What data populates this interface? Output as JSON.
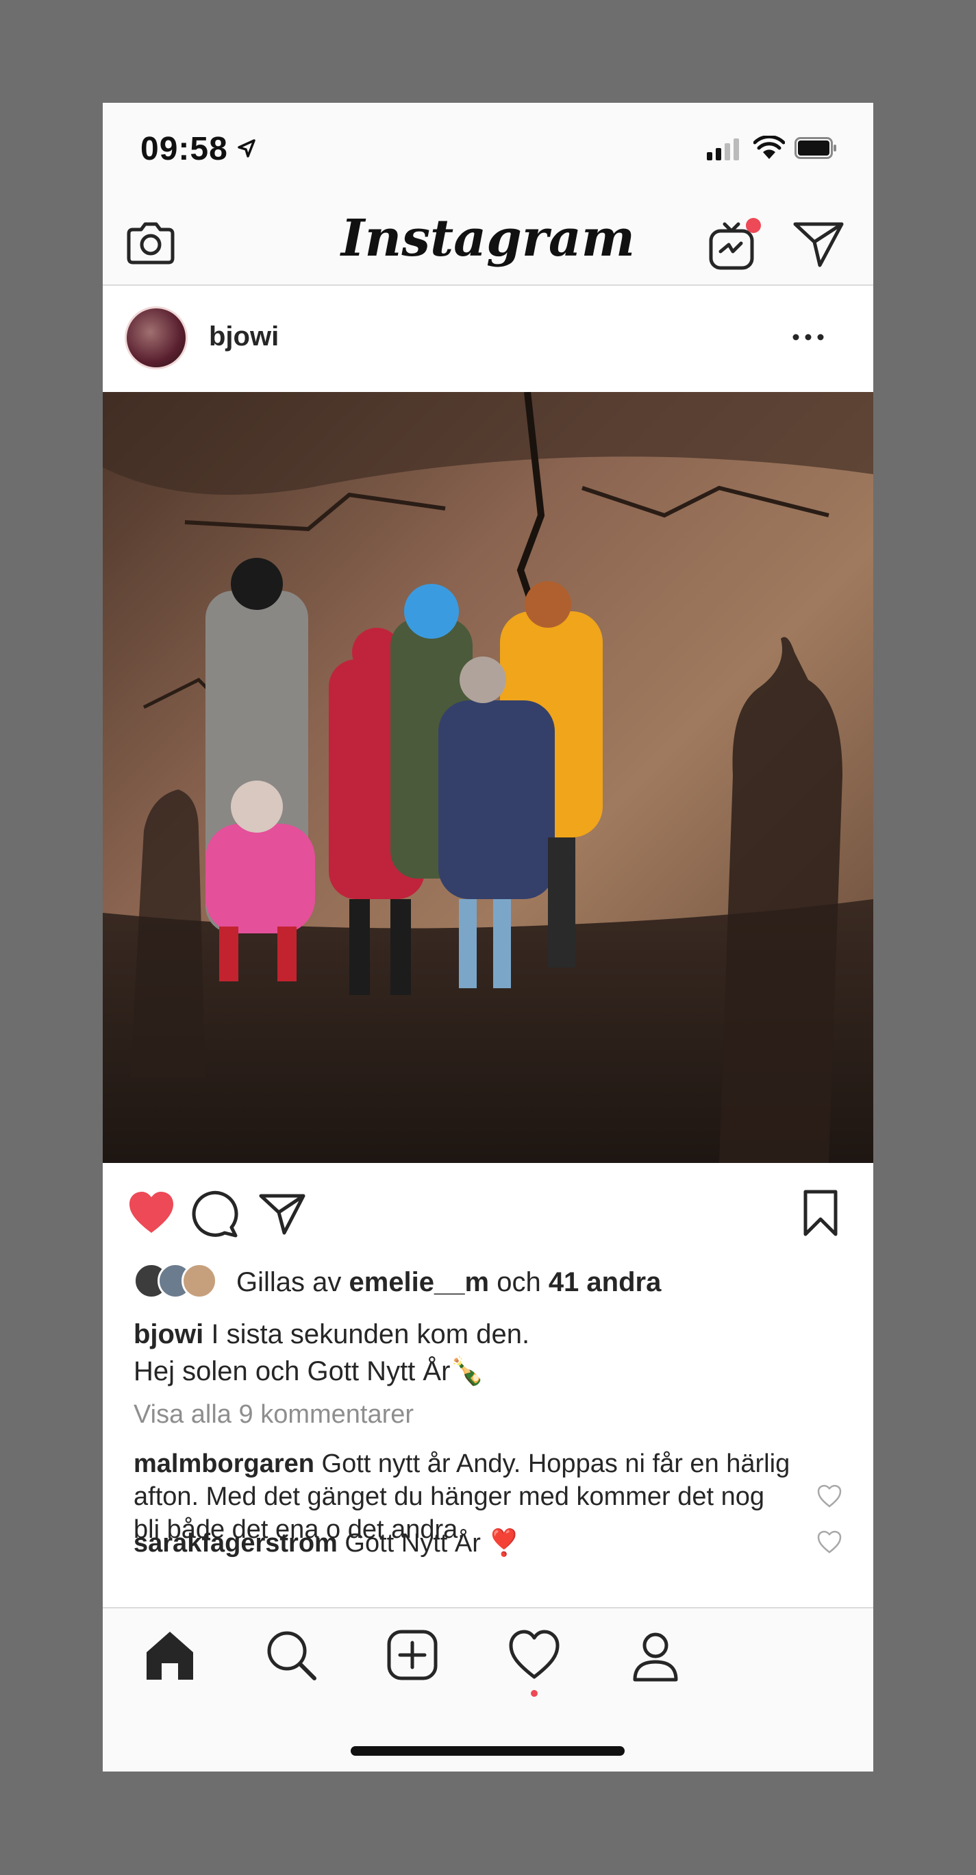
{
  "status_bar": {
    "time": "09:58"
  },
  "header": {
    "logo": "Instagram"
  },
  "post": {
    "username": "bjowi",
    "likes": {
      "prefix": "Gillas av ",
      "user": "emelie__m",
      "middle": " och ",
      "others": "41 andra"
    },
    "caption": {
      "user": "bjowi",
      "line1": "I sista sekunden kom den.",
      "line2": "Hej solen och Gott Nytt År🍾"
    },
    "view_all_comments": "Visa alla 9 kommentarer",
    "comments": [
      {
        "user": "malmborgaren",
        "text": "Gott nytt år Andy. Hoppas ni får en härlig afton. Med det gänget du hänger med kommer det nog bli både det ena o det andra."
      },
      {
        "user": "sarakfagerstrom",
        "text": "Gott Nytt År ❣️"
      }
    ]
  },
  "colors": {
    "like_red": "#ed4956",
    "notification_red": "#ed4956",
    "muted_gray": "#8e8e8e"
  },
  "icons": [
    "location-arrow-icon",
    "signal-icon",
    "wifi-icon",
    "battery-icon",
    "camera-icon",
    "igtv-icon",
    "direct-message-icon",
    "more-options-icon",
    "heart-filled-icon",
    "comment-icon",
    "share-icon",
    "bookmark-icon",
    "heart-outline-icon",
    "home-icon",
    "search-icon",
    "add-post-icon",
    "activity-heart-icon",
    "profile-icon"
  ]
}
